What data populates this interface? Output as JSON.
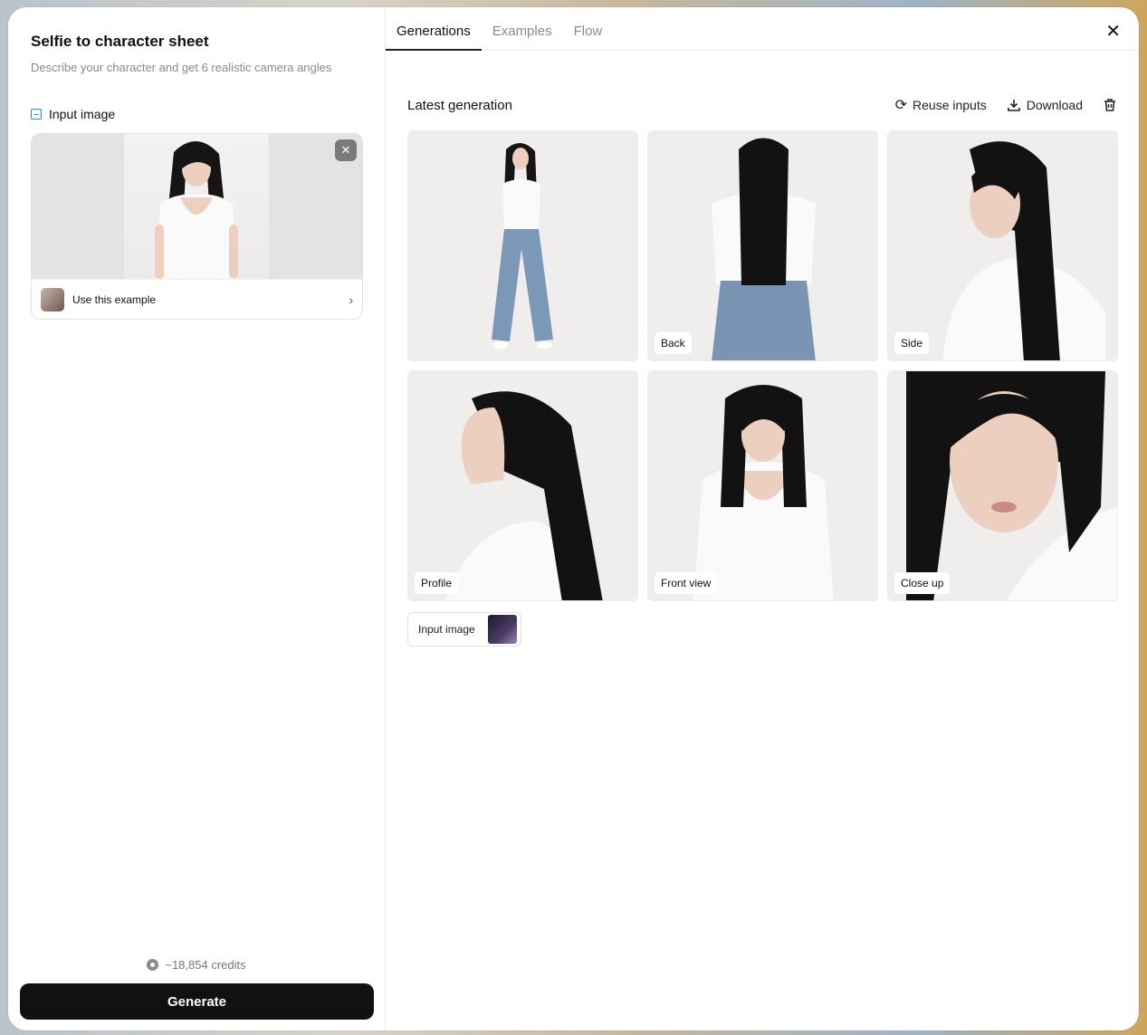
{
  "left": {
    "title": "Selfie to character sheet",
    "subtitle": "Describe your character and get 6 realistic camera angles",
    "input_label": "Input image",
    "example_label": "Use this example",
    "credits": "~18,854 credits",
    "generate_label": "Generate"
  },
  "tabs": [
    {
      "label": "Generations",
      "active": true
    },
    {
      "label": "Examples",
      "active": false
    },
    {
      "label": "Flow",
      "active": false
    }
  ],
  "generation": {
    "title": "Latest generation",
    "reuse_label": "Reuse inputs",
    "download_label": "Download",
    "tiles": [
      {
        "label": ""
      },
      {
        "label": "Back"
      },
      {
        "label": "Side"
      },
      {
        "label": "Profile"
      },
      {
        "label": "Front view"
      },
      {
        "label": "Close up"
      }
    ],
    "input_chip_label": "Input image"
  },
  "icons": {
    "close": "close-icon",
    "reuse": "refresh-icon",
    "download": "download-icon",
    "delete": "trash-icon",
    "coin": "credits-coin-icon",
    "image": "image-icon"
  }
}
